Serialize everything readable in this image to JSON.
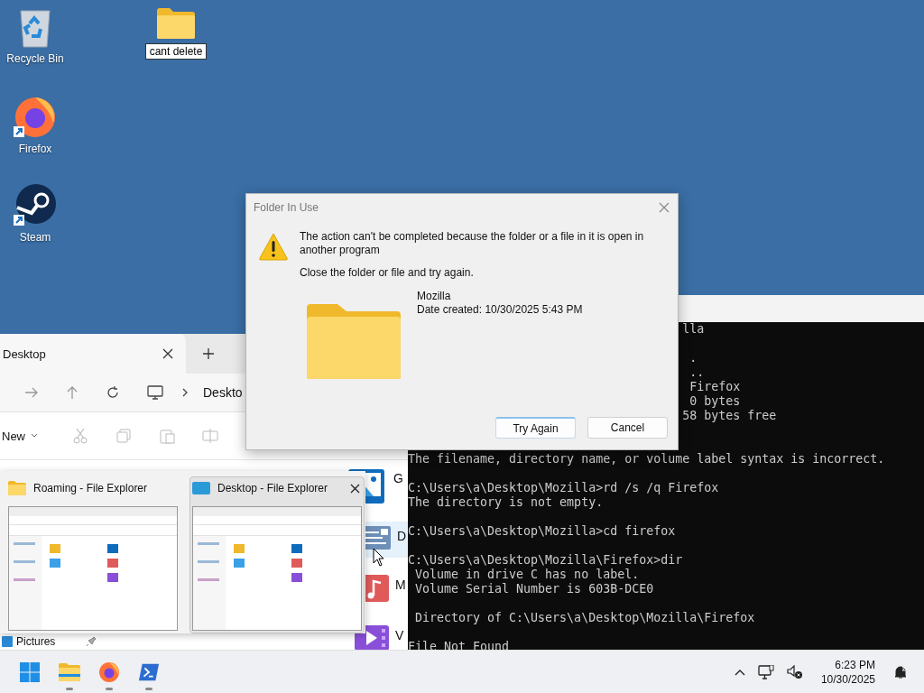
{
  "desktop_icons": [
    {
      "label": "Recycle Bin",
      "kind": "recycle",
      "renaming": false
    },
    {
      "label": "Firefox",
      "kind": "firefox",
      "renaming": false
    },
    {
      "label": "Steam",
      "kind": "steam",
      "renaming": false
    },
    {
      "label": "cant delete",
      "kind": "folder",
      "renaming": true
    }
  ],
  "explorer": {
    "tab": "Desktop",
    "address": "Deskto",
    "new_label": "New",
    "content": [
      {
        "label": "G",
        "kind": "pictures",
        "hovered": false
      },
      {
        "label": "D",
        "kind": "documents",
        "hovered": true
      },
      {
        "label": "M",
        "kind": "music",
        "hovered": false
      },
      {
        "label": "V",
        "kind": "videos",
        "hovered": false
      }
    ],
    "sidebar": [
      {
        "label": "Pictures",
        "pinned": true
      }
    ]
  },
  "thumbnails": [
    {
      "title": "Roaming - File Explorer",
      "kind": "folder",
      "hovered": false
    },
    {
      "title": "Desktop - File Explorer",
      "kind": "desktop",
      "hovered": true
    }
  ],
  "terminal": {
    "top_blocks": [
      [
        "lla"
      ],
      [
        ".",
        "..",
        "Firefox",
        "0 bytes",
        "58 bytes free"
      ]
    ],
    "blocks": [
      [
        "The filename, directory name, or volume label syntax is incorrect."
      ],
      [
        "C:\\Users\\a\\Desktop\\Mozilla>rd /s /q Firefox",
        "The directory is not empty."
      ],
      [
        "C:\\Users\\a\\Desktop\\Mozilla>cd firefox"
      ],
      [
        "C:\\Users\\a\\Desktop\\Mozilla\\Firefox>dir",
        " Volume in drive C has no label.",
        " Volume Serial Number is 603B-DCE0"
      ],
      [
        " Directory of C:\\Users\\a\\Desktop\\Mozilla\\Firefox"
      ],
      [
        "File Not Found"
      ]
    ]
  },
  "dialog": {
    "title": "Folder In Use",
    "active": false,
    "message": "The action can't be completed because the folder or a file in it is open in another program",
    "hint": "Close the folder or file and try again.",
    "item_name": "Mozilla",
    "item_date": "Date created: 10/30/2025 5:43 PM",
    "buttons": [
      {
        "label": "Try Again",
        "default": true
      },
      {
        "label": "Cancel",
        "default": false
      }
    ]
  },
  "taskbar": {
    "apps": [
      {
        "kind": "start"
      },
      {
        "kind": "explorer",
        "running": true
      },
      {
        "kind": "firefox",
        "running": true
      },
      {
        "kind": "terminal",
        "running": true
      }
    ],
    "time": "6:23 PM",
    "date": "10/30/2025"
  }
}
